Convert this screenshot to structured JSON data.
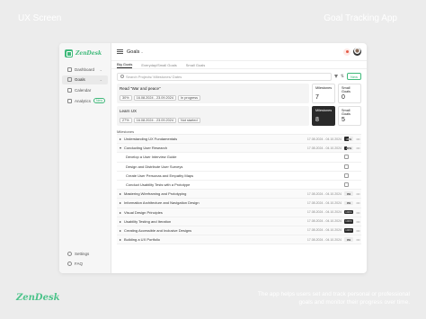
{
  "frame": {
    "label_left": "UX Screen",
    "label_right": "Goal Tracking App",
    "brand": "ZenDesk",
    "caption": "The app helps users set and track personal or professional goals and monitor their progress over time."
  },
  "sidebar": {
    "logo": "ZenDesk",
    "items": [
      {
        "label": "Dashboard",
        "icon": "dashboard-icon"
      },
      {
        "label": "Goals",
        "icon": "target-icon"
      },
      {
        "label": "Calendar",
        "icon": "calendar-icon"
      },
      {
        "label": "Analytics",
        "icon": "chart-icon",
        "badge": "New"
      }
    ],
    "bottom": [
      {
        "label": "Settings",
        "icon": "gear-icon"
      },
      {
        "label": "FAQ",
        "icon": "help-icon"
      }
    ]
  },
  "header": {
    "title": "Goals"
  },
  "tabs": [
    "Big Goals",
    "Everyday/Small Goals",
    "Small Goals"
  ],
  "toolbar": {
    "search_placeholder": "Search Projects/ Milestones/ Dates",
    "new_label": "New"
  },
  "goals": [
    {
      "name": "Read \"War and peace\"",
      "progress": "30%",
      "dates": "16.08.2024 - 23.09.2024",
      "status": "In progress",
      "milestones_label": "Milestones",
      "milestones_value": "7",
      "small_label": "Small Goals",
      "small_value": "0"
    },
    {
      "name": "Learn UX",
      "progress": "27%",
      "dates": "16.08.2024 - 23.09.2024",
      "status": "Not started",
      "milestones_label": "Milestones",
      "milestones_value": "8",
      "small_label": "Small Goals",
      "small_value": "5"
    }
  ],
  "milestones_header": "Milestones",
  "milestones": [
    {
      "name": "Understanding UX Fundamentals",
      "dates": "17.08.2024 - 04.10.2024",
      "progress": 0.45,
      "progress_label": "45%",
      "type": "parent"
    },
    {
      "name": "Conducting User Research",
      "dates": "17.08.2024 - 04.10.2024",
      "progress": 0.3,
      "progress_label": "30%",
      "type": "parent"
    },
    {
      "name": "Develop a User Interview Guide",
      "type": "child",
      "checked": false
    },
    {
      "name": "Design and Distribute User Surveys",
      "type": "child",
      "checked": false
    },
    {
      "name": "Create User Personas and Empathy Maps",
      "type": "child",
      "checked": false
    },
    {
      "name": "Conduct Usability Tests with a Prototype",
      "type": "child",
      "checked": false
    },
    {
      "name": "Mastering Wireframing and Prototyping",
      "dates": "17.08.2024 - 04.10.2024",
      "progress": 0.0,
      "progress_label": "0%",
      "type": "parent"
    },
    {
      "name": "Information Architecture and Navigation Design",
      "dates": "17.08.2024 - 04.10.2024",
      "progress": 0.0,
      "progress_label": "0%",
      "type": "parent"
    },
    {
      "name": "Visual Design Principles",
      "dates": "17.08.2024 - 04.10.2024",
      "progress": 1.0,
      "progress_label": "100%",
      "type": "parent"
    },
    {
      "name": "Usability Testing and Iteration",
      "dates": "17.08.2024 - 04.10.2024",
      "progress": 1.0,
      "progress_label": "100%",
      "type": "parent"
    },
    {
      "name": "Creating Accessible and Inclusive Designs",
      "dates": "17.08.2024 - 04.10.2024",
      "progress": 1.0,
      "progress_label": "100%",
      "type": "parent"
    },
    {
      "name": "Building a UX Portfolio",
      "dates": "17.08.2024 - 04.10.2024",
      "progress": 0.0,
      "progress_label": "0%",
      "type": "parent"
    }
  ],
  "colors": {
    "accent": "#3fb97a",
    "dark": "#2a2a2a",
    "backdrop": "#ececec"
  }
}
